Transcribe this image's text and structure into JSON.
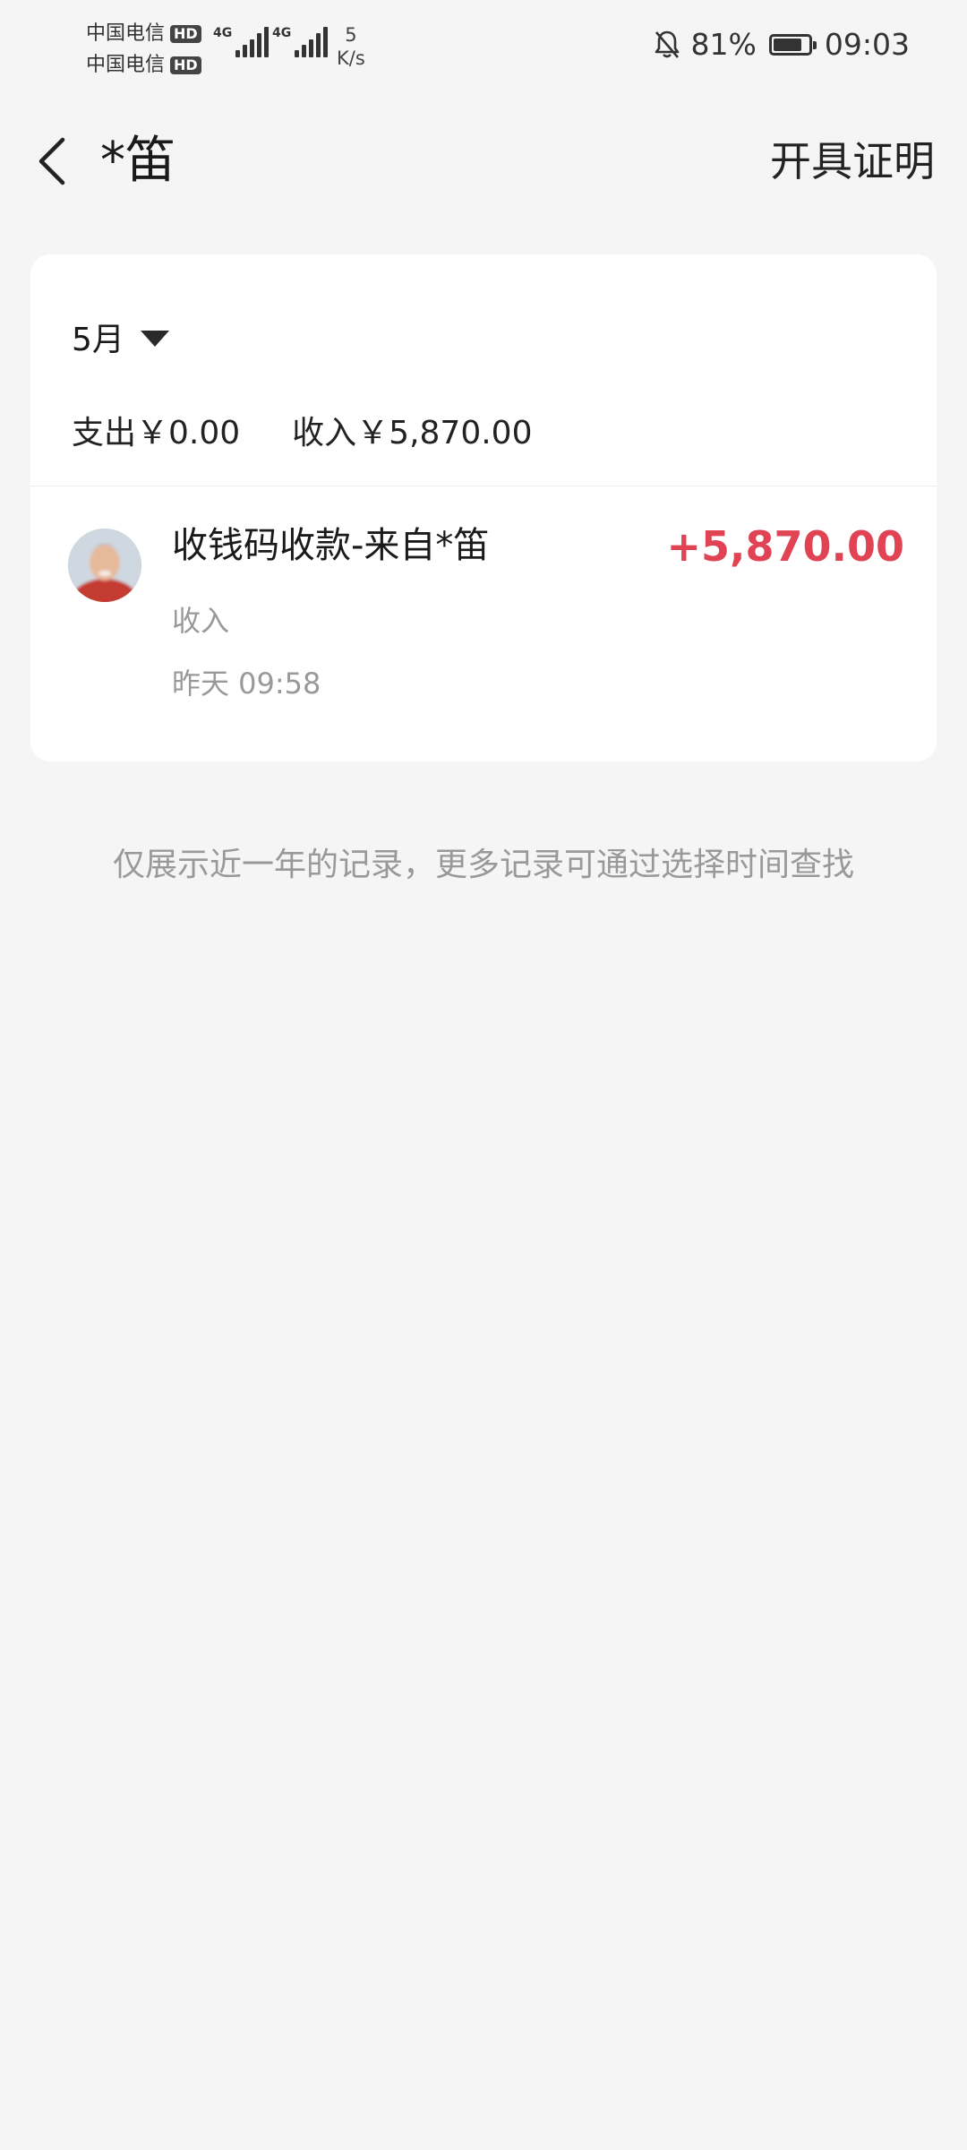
{
  "status_bar": {
    "carrier_1": "中国电信",
    "carrier_2": "中国电信",
    "hd_badge": "HD",
    "network_tag_1": "4G",
    "network_tag_2": "4G",
    "net_speed_value": "5",
    "net_speed_unit": "K/s",
    "battery_percent": "81%",
    "battery_level": 0.81,
    "time": "09:03"
  },
  "header": {
    "title": "*笛",
    "cert_label": "开具证明"
  },
  "summary": {
    "month": "5月",
    "expense": "支出￥0.00",
    "income": "收入￥5,870.00"
  },
  "transaction": {
    "title": "收钱码收款-来自*笛",
    "type": "收入",
    "time": "昨天 09:58",
    "amount": "+5,870.00"
  },
  "footnote": "仅展示近一年的记录，更多记录可通过选择时间查找",
  "colors": {
    "amount_red": "#e04354",
    "background": "#f5f5f5"
  }
}
